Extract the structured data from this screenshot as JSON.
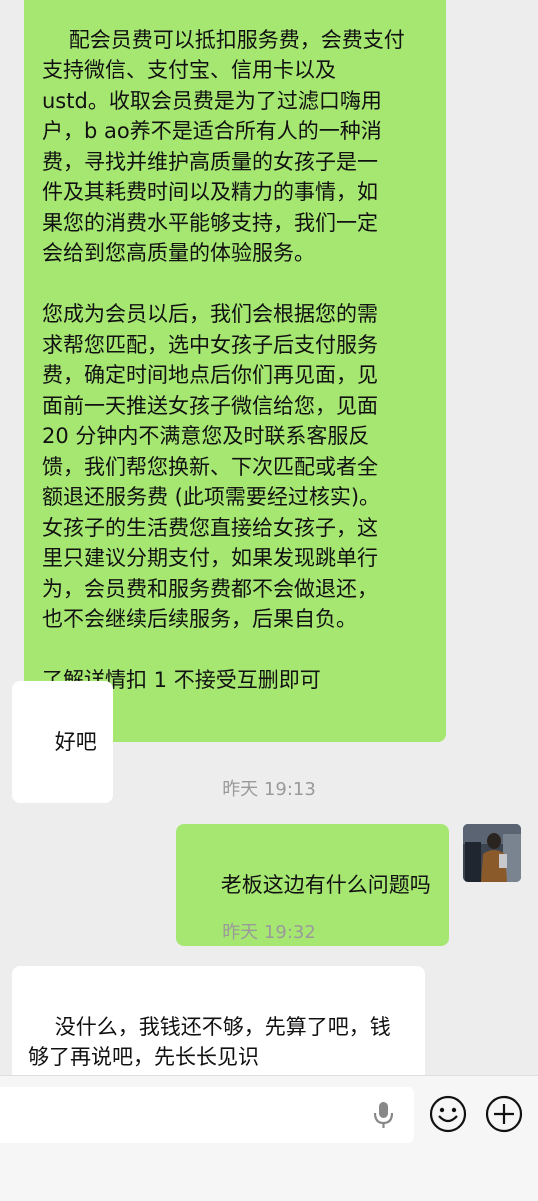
{
  "messages": {
    "long_text": "配会员费可以抵扣服务费，会费支付\n支持微信、支付宝、信用卡以及\nustd。收取会员费是为了过滤口嗨用\n户，b ao养不是适合所有人的一种消\n费，寻找并维护高质量的女孩子是一\n件及其耗费时间以及精力的事情，如\n果您的消费水平能够支持，我们一定\n会给到您高质量的体验服务。\n\n您成为会员以后，我们会根据您的需\n求帮您匹配，选中女孩子后支付服务\n费，确定时间地点后你们再见面，见\n面前一天推送女孩子微信给您，见面\n20 分钟内不满意您及时联系客服反\n馈，我们帮您换新、下次匹配或者全\n额退还服务费 (此项需要经过核实)。\n女孩子的生活费您直接给女孩子，这\n里只建议分期支付，如果发现跳单行\n为，会员费和服务费都不会做退还，\n也不会继续后续服务，后果自负。\n\n了解详情扣 1 不接受互删即可",
    "reply_ok": "好吧",
    "time_1": "昨天 19:13",
    "sent_question": "老板这边有什么问题吗",
    "time_2": "昨天 19:32",
    "last_reply": "没什么，我钱还不够，先算了吧，钱\n够了再说吧，先长长见识"
  },
  "colors": {
    "sent_bubble": "#a6e772",
    "received_bubble": "#ffffff",
    "background": "#ededed"
  },
  "icons": {
    "voice": "microphone-icon",
    "emoji": "smiley-icon",
    "more": "plus-circle-icon"
  }
}
